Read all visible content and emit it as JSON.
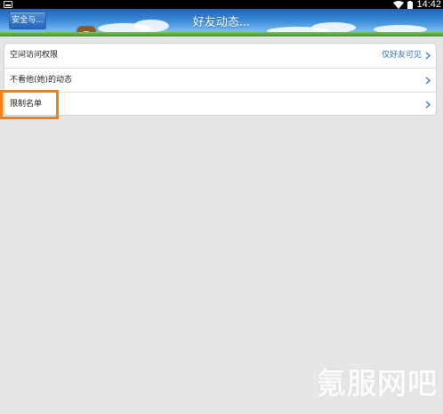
{
  "status_bar": {
    "time": "14:42",
    "icons": [
      "notification-icon",
      "wifi-icon",
      "battery-icon"
    ]
  },
  "header": {
    "back_label": "安全与...",
    "title": "好友动态..."
  },
  "settings": {
    "rows": [
      {
        "label": "空间访问权限",
        "value": "仅好友可见"
      },
      {
        "label": "不看他(她)的动态"
      },
      {
        "label": "限制名单"
      }
    ]
  },
  "watermark": "氪服网吧",
  "colors": {
    "header_blue": "#2f7fd0",
    "link_blue": "#2a6fc2",
    "highlight": "#f57f17",
    "background": "#e6e6e6"
  }
}
